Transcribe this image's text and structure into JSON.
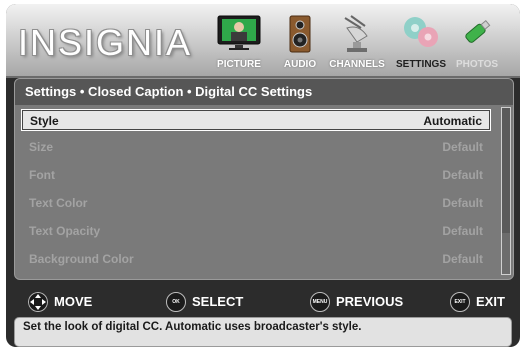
{
  "brand": "INSIGNIA",
  "tabs": [
    {
      "label": "PICTURE",
      "icon": "tv-icon"
    },
    {
      "label": "AUDIO",
      "icon": "speaker-icon"
    },
    {
      "label": "CHANNELS",
      "icon": "satellite-dish-icon"
    },
    {
      "label": "SETTINGS",
      "icon": "gears-icon",
      "active": true
    },
    {
      "label": "PHOTOS",
      "icon": "usb-stick-icon",
      "disabled": true
    }
  ],
  "breadcrumb": "Settings • Closed Caption • Digital CC Settings",
  "settings": [
    {
      "name": "Style",
      "value": "Automatic",
      "selected": true
    },
    {
      "name": "Size",
      "value": "Default"
    },
    {
      "name": "Font",
      "value": "Default"
    },
    {
      "name": "Text Color",
      "value": "Default"
    },
    {
      "name": "Text Opacity",
      "value": "Default"
    },
    {
      "name": "Background Color",
      "value": "Default"
    }
  ],
  "nav": {
    "move": {
      "label": "MOVE",
      "icon": "dpad-icon"
    },
    "select": {
      "label": "SELECT",
      "icon_text": "OK ENTER"
    },
    "previous": {
      "label": "PREVIOUS",
      "icon_text": "MENU"
    },
    "exit": {
      "label": "EXIT",
      "icon_text": "EXIT"
    }
  },
  "help_text": "Set the look of digital CC. Automatic uses broadcaster's style."
}
